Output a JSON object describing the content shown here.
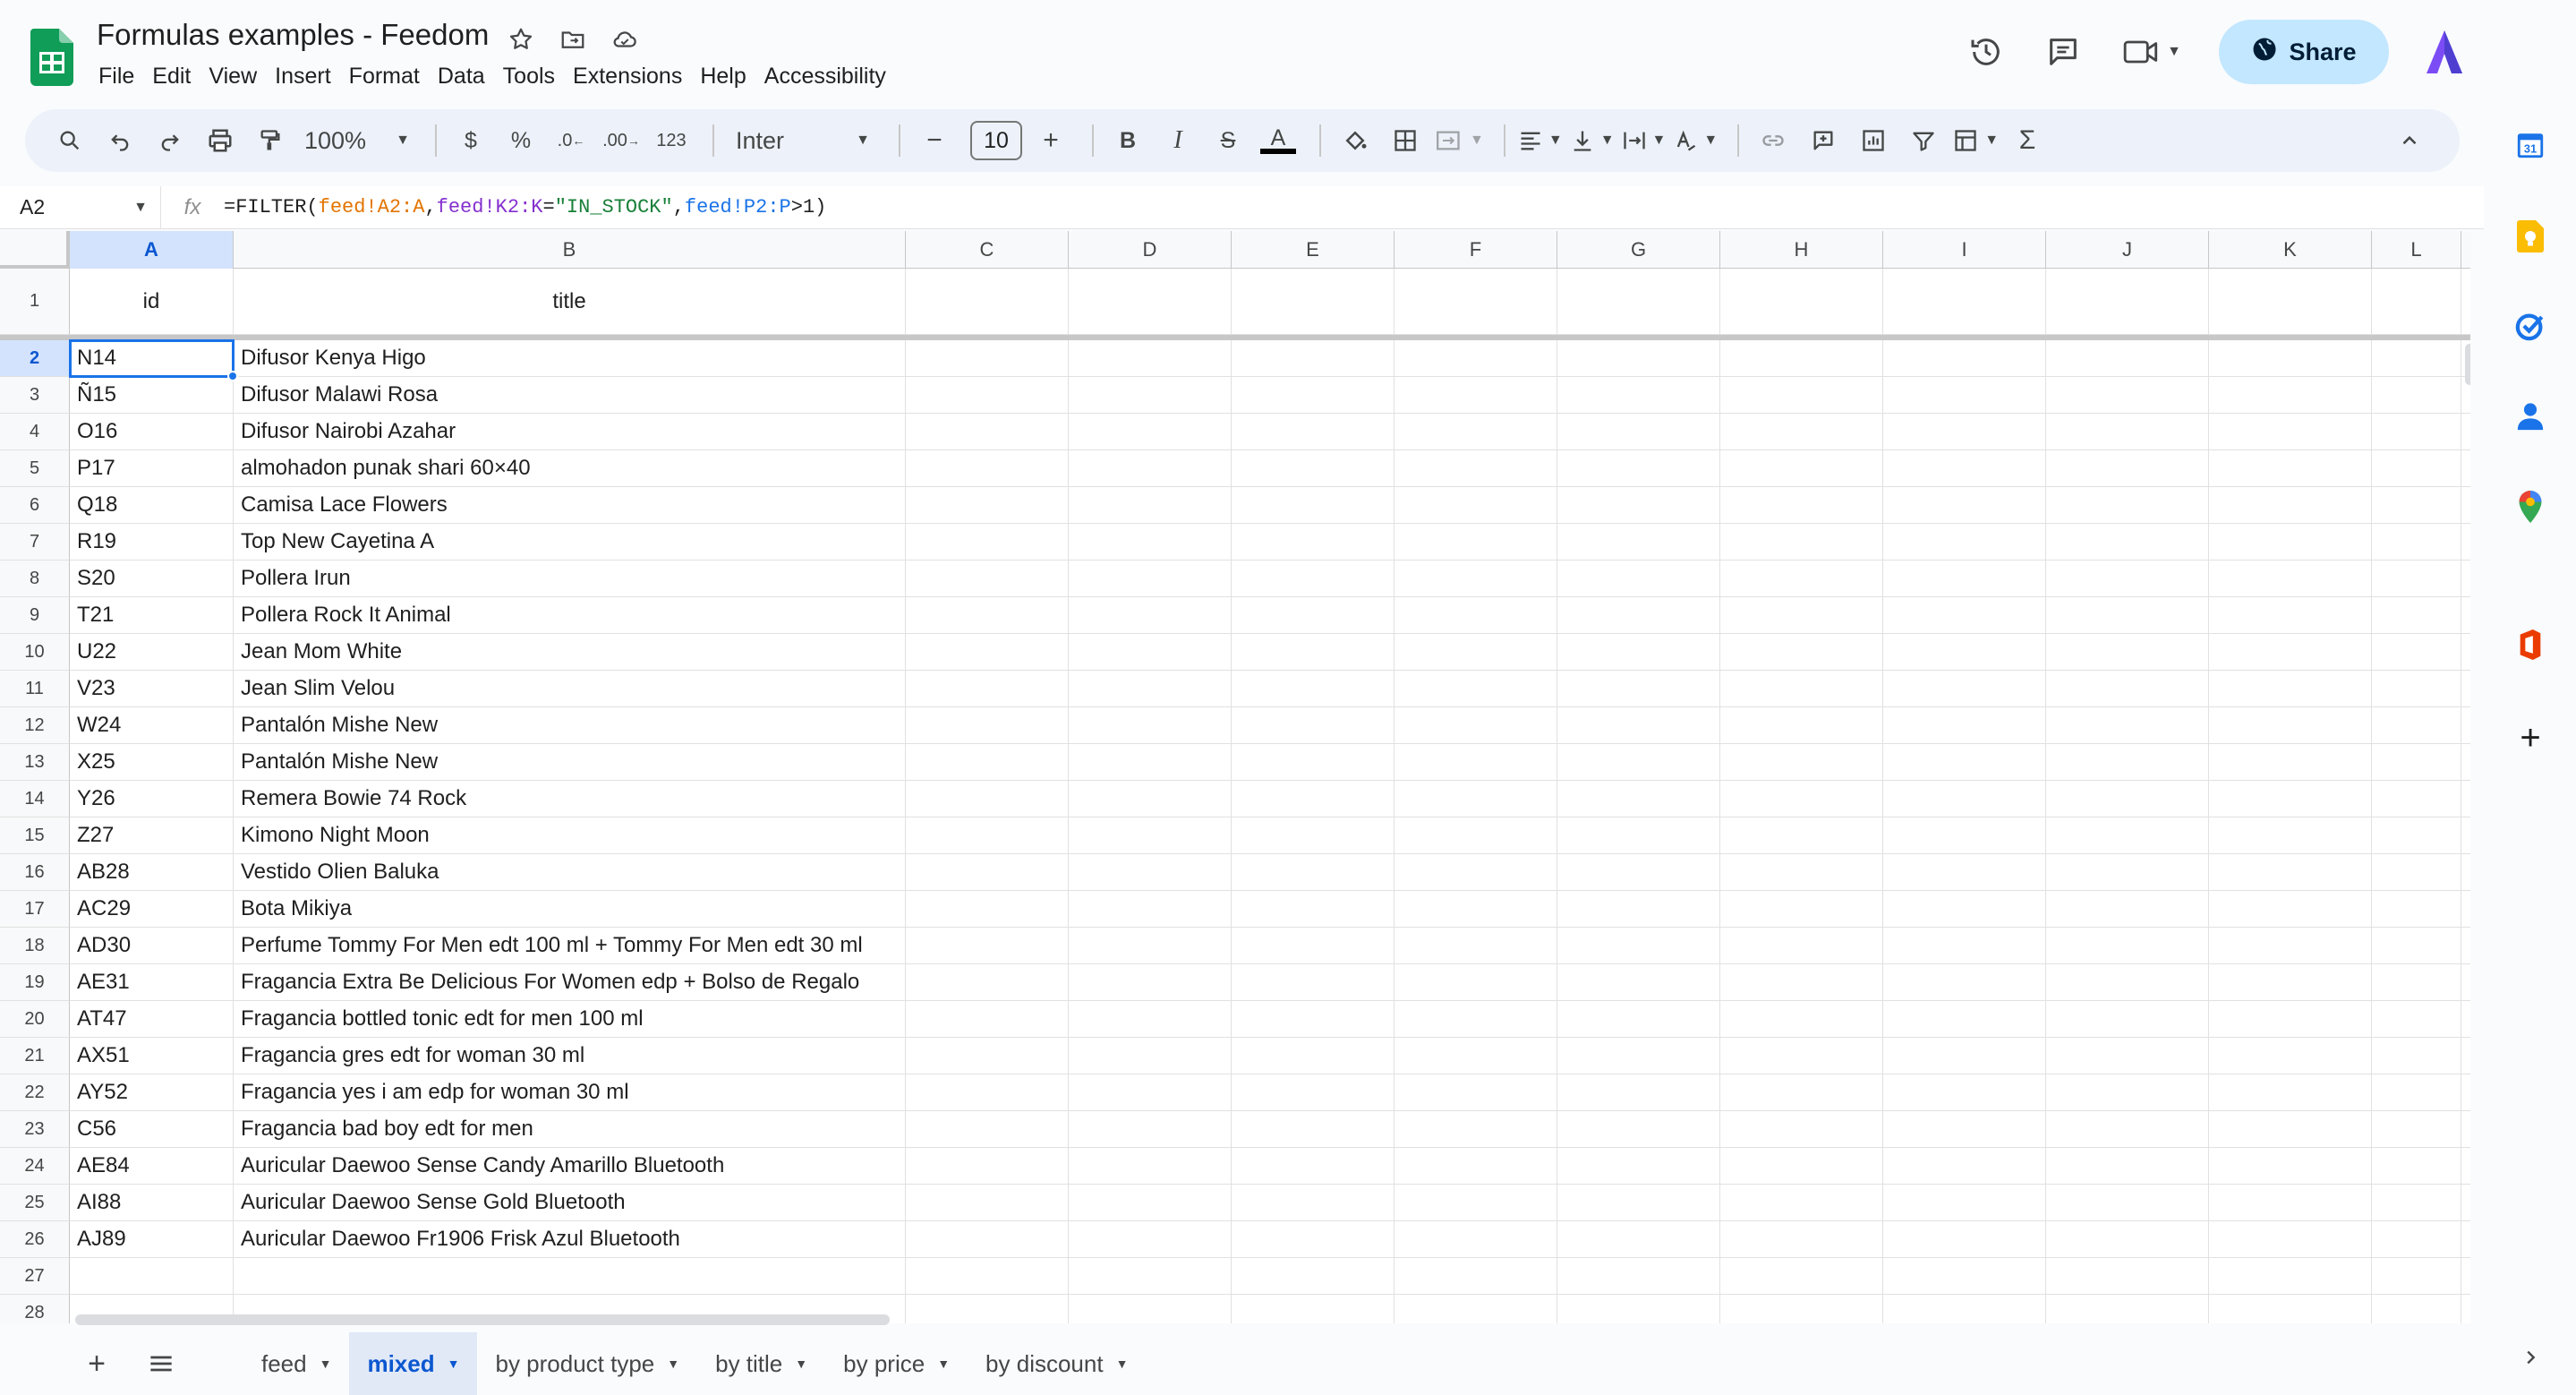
{
  "app": {
    "doc_title": "Formulas examples - Feedom",
    "menu": [
      "File",
      "Edit",
      "View",
      "Insert",
      "Format",
      "Data",
      "Tools",
      "Extensions",
      "Help",
      "Accessibility"
    ],
    "share_label": "Share"
  },
  "toolbar": {
    "zoom": "100%",
    "currency": "$",
    "percent": "%",
    "decrease_decimal": ".0",
    "increase_decimal": ".00",
    "number_format": "123",
    "font": "Inter",
    "font_size": "10",
    "minus": "−",
    "plus": "+",
    "bold": "B",
    "italic": "I",
    "strikethrough": "S",
    "text_color_letter": "A",
    "sum": "Σ"
  },
  "formula_bar": {
    "cell_ref": "A2",
    "fx": "fx",
    "formula_parts": [
      "=FILTER(",
      "feed!A2:A",
      ",",
      "feed!K2:K",
      "=",
      "\"IN_STOCK\"",
      ",",
      "feed!P2:P",
      ">1)"
    ]
  },
  "grid": {
    "columns": [
      "A",
      "B",
      "C",
      "D",
      "E",
      "F",
      "G",
      "H",
      "I",
      "J",
      "K",
      "L"
    ],
    "header_row": {
      "num": "1",
      "a": "id",
      "b": "title"
    },
    "rows": [
      {
        "num": "2",
        "a": "N14",
        "b": "Difusor Kenya Higo"
      },
      {
        "num": "3",
        "a": "Ñ15",
        "b": "Difusor Malawi Rosa"
      },
      {
        "num": "4",
        "a": "O16",
        "b": "Difusor Nairobi Azahar"
      },
      {
        "num": "5",
        "a": "P17",
        "b": "almohadon punak shari 60×40"
      },
      {
        "num": "6",
        "a": "Q18",
        "b": "Camisa Lace Flowers"
      },
      {
        "num": "7",
        "a": "R19",
        "b": "Top New Cayetina A"
      },
      {
        "num": "8",
        "a": "S20",
        "b": "Pollera Irun"
      },
      {
        "num": "9",
        "a": "T21",
        "b": "Pollera Rock It Animal"
      },
      {
        "num": "10",
        "a": "U22",
        "b": "Jean Mom White"
      },
      {
        "num": "11",
        "a": "V23",
        "b": "Jean Slim Velou"
      },
      {
        "num": "12",
        "a": "W24",
        "b": "Pantalón Mishe New"
      },
      {
        "num": "13",
        "a": "X25",
        "b": "Pantalón Mishe New"
      },
      {
        "num": "14",
        "a": "Y26",
        "b": "Remera Bowie 74 Rock"
      },
      {
        "num": "15",
        "a": "Z27",
        "b": "Kimono Night Moon"
      },
      {
        "num": "16",
        "a": "AB28",
        "b": "Vestido Olien Baluka"
      },
      {
        "num": "17",
        "a": "AC29",
        "b": "Bota Mikiya"
      },
      {
        "num": "18",
        "a": "AD30",
        "b": "Perfume Tommy For Men edt 100 ml + Tommy For Men edt 30 ml"
      },
      {
        "num": "19",
        "a": "AE31",
        "b": "Fragancia Extra Be Delicious For Women edp + Bolso de Regalo"
      },
      {
        "num": "20",
        "a": "AT47",
        "b": "Fragancia bottled tonic edt for men 100 ml"
      },
      {
        "num": "21",
        "a": "AX51",
        "b": "Fragancia gres edt for woman 30 ml"
      },
      {
        "num": "22",
        "a": "AY52",
        "b": "Fragancia yes i am edp for woman 30 ml"
      },
      {
        "num": "23",
        "a": "C56",
        "b": "Fragancia bad boy edt for men"
      },
      {
        "num": "24",
        "a": "AE84",
        "b": "Auricular Daewoo Sense Candy Amarillo Bluetooth"
      },
      {
        "num": "25",
        "a": "AI88",
        "b": "Auricular Daewoo Sense Gold Bluetooth"
      },
      {
        "num": "26",
        "a": "AJ89",
        "b": "Auricular Daewoo Fr1906 Frisk Azul Bluetooth"
      },
      {
        "num": "27",
        "a": "",
        "b": ""
      },
      {
        "num": "28",
        "a": "",
        "b": ""
      }
    ],
    "selected_cell": "A2"
  },
  "sheets": {
    "tabs": [
      "feed",
      "mixed",
      "by product type",
      "by title",
      "by price",
      "by discount"
    ],
    "active": "mixed"
  },
  "colors": {
    "accent": "#1a73e8",
    "share_bg": "#c2e7ff",
    "toolbar_bg": "#edf2fa",
    "selected_header": "#d3e3fd"
  },
  "icons": {
    "header": [
      "sheets-logo-icon",
      "star-icon",
      "move-folder-icon",
      "cloud-status-icon",
      "history-icon",
      "comment-icon",
      "meet-icon",
      "globe-icon",
      "gemini-icon"
    ],
    "side_panel": [
      "calendar-icon",
      "keep-icon",
      "tasks-icon",
      "contacts-icon",
      "maps-icon",
      "office-addon-icon",
      "add-icon",
      "collapse-panel-icon"
    ]
  }
}
